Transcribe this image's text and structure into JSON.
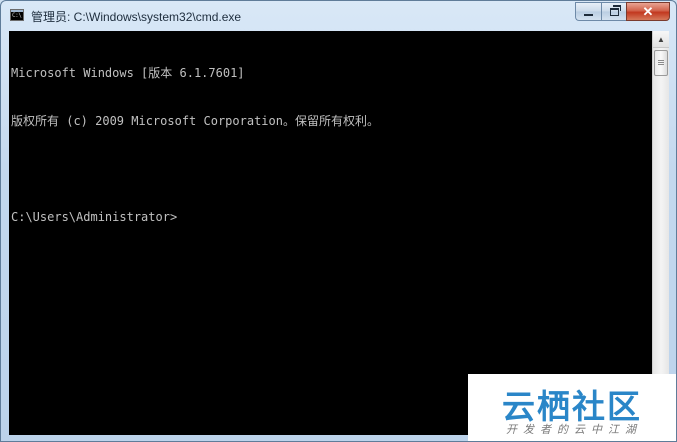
{
  "window": {
    "title": "管理员: C:\\Windows\\system32\\cmd.exe",
    "icon_label": "C:\\",
    "buttons": {
      "close_glyph": "✕"
    }
  },
  "console": {
    "lines": [
      "Microsoft Windows [版本 6.1.7601]",
      "版权所有 (c) 2009 Microsoft Corporation。保留所有权利。",
      "",
      "C:\\Users\\Administrator>"
    ]
  },
  "scrollbar": {
    "up_glyph": "▲"
  },
  "watermark": {
    "main": "云栖社区",
    "sub": "开发者的云中江湖"
  },
  "colors": {
    "console_bg": "#000000",
    "console_fg": "#c0c0c0",
    "close_button": "#c2381f",
    "watermark_blue": "#2a86c8"
  }
}
